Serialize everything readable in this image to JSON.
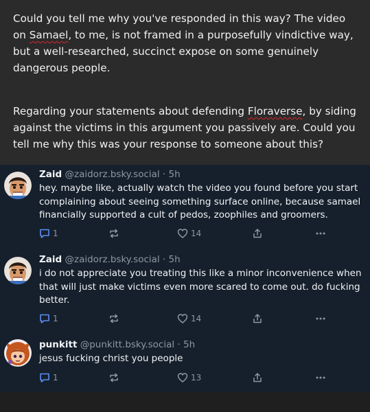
{
  "composer": {
    "para1_a": "Could you tell me why you've responded in this way? The video on ",
    "para1_word": "Samael",
    "para1_b": ", to me, is not framed in a purposefully vindictive way, but a well-researched, succinct expose on some genuinely dangerous people.",
    "para2_a": "Regarding your statements about defending ",
    "para2_word": "Floraverse",
    "para2_b": ", by siding against the victims in this argument you passively are. Could you tell me why this was your response to someone about this?"
  },
  "posts": [
    {
      "name": "Zaid",
      "handle": "@zaidorz.bsky.social · 5h",
      "text": "hey. maybe like, actually watch the video you found before you start complaining about seeing something surface online, because samael financially supported a cult of pedos, zoophiles and groomers.",
      "replies": "1",
      "likes": "14"
    },
    {
      "name": "Zaid",
      "handle": "@zaidorz.bsky.social · 5h",
      "text": "i do not appreciate you treating this like a minor inconvenience when that will just make victims even more scared to come out. do fucking better.",
      "replies": "1",
      "likes": "14"
    },
    {
      "name": "punkitt",
      "handle": "@punkitt.bsky.social · 5h",
      "text": "jesus fucking christ you people",
      "replies": "1",
      "likes": "13"
    }
  ],
  "colors": {
    "composer_bg": "#2b2b2b",
    "feed_bg": "#16202c",
    "muted": "#8b98a5",
    "spell_underline": "#d9252a"
  },
  "icons": [
    "reply-icon",
    "repost-icon",
    "like-icon",
    "share-icon",
    "more-icon"
  ]
}
